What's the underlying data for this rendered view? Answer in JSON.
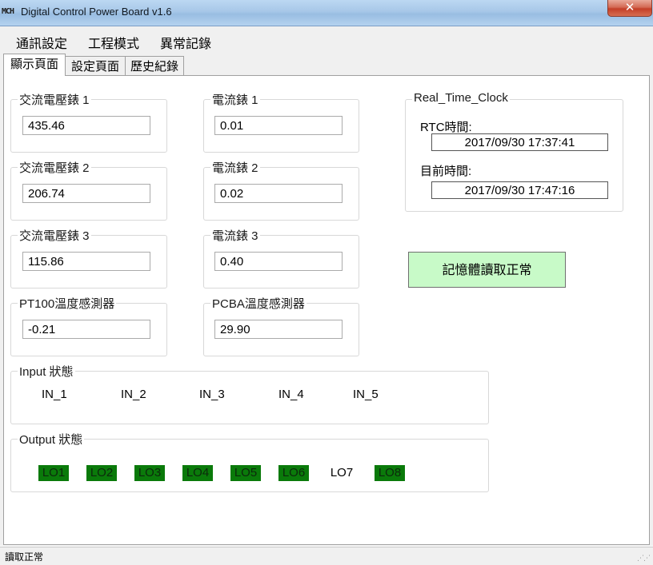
{
  "window": {
    "logo_text": "MCH",
    "title": "Digital Control Power Board v1.6",
    "close_glyph": "✕"
  },
  "menu": [
    "通訊設定",
    "工程模式",
    "異常記錄"
  ],
  "tabs": [
    "顯示頁面",
    "設定頁面",
    "歷史紀錄"
  ],
  "voltmeters": [
    {
      "label": "交流電壓錶 1",
      "value": "435.46"
    },
    {
      "label": "交流電壓錶 2",
      "value": "206.74"
    },
    {
      "label": "交流電壓錶 3",
      "value": "115.86"
    }
  ],
  "ammeters": [
    {
      "label": "電流錶 1",
      "value": "0.01"
    },
    {
      "label": "電流錶 2",
      "value": "0.02"
    },
    {
      "label": "電流錶 3",
      "value": "0.40"
    }
  ],
  "pt100": {
    "label": "PT100溫度感測器",
    "value": "-0.21"
  },
  "pcba": {
    "label": "PCBA溫度感測器",
    "value": "29.90"
  },
  "clock": {
    "group_title": "Real_Time_Clock",
    "rtc_label": "RTC時間:",
    "rtc_value": "2017/09/30 17:37:41",
    "now_label": "目前時間:",
    "now_value": "2017/09/30 17:47:16"
  },
  "memory_status": "記憶體讀取正常",
  "input": {
    "title": "Input 狀態",
    "items": [
      "IN_1",
      "IN_2",
      "IN_3",
      "IN_4",
      "IN_5"
    ]
  },
  "output": {
    "title": "Output 狀態",
    "items": [
      {
        "label": "LO1",
        "on": true
      },
      {
        "label": "LO2",
        "on": true
      },
      {
        "label": "LO3",
        "on": true
      },
      {
        "label": "LO4",
        "on": true
      },
      {
        "label": "LO5",
        "on": true
      },
      {
        "label": "LO6",
        "on": true
      },
      {
        "label": "LO7",
        "on": false
      },
      {
        "label": "LO8",
        "on": true
      }
    ],
    "on_color": "#0a7a0a"
  },
  "status_bar": "讀取正常",
  "colors": {
    "memory_ok_bg": "#c8fac8",
    "title_bar": "#a7c7e8",
    "close_btn": "#c43f28"
  }
}
